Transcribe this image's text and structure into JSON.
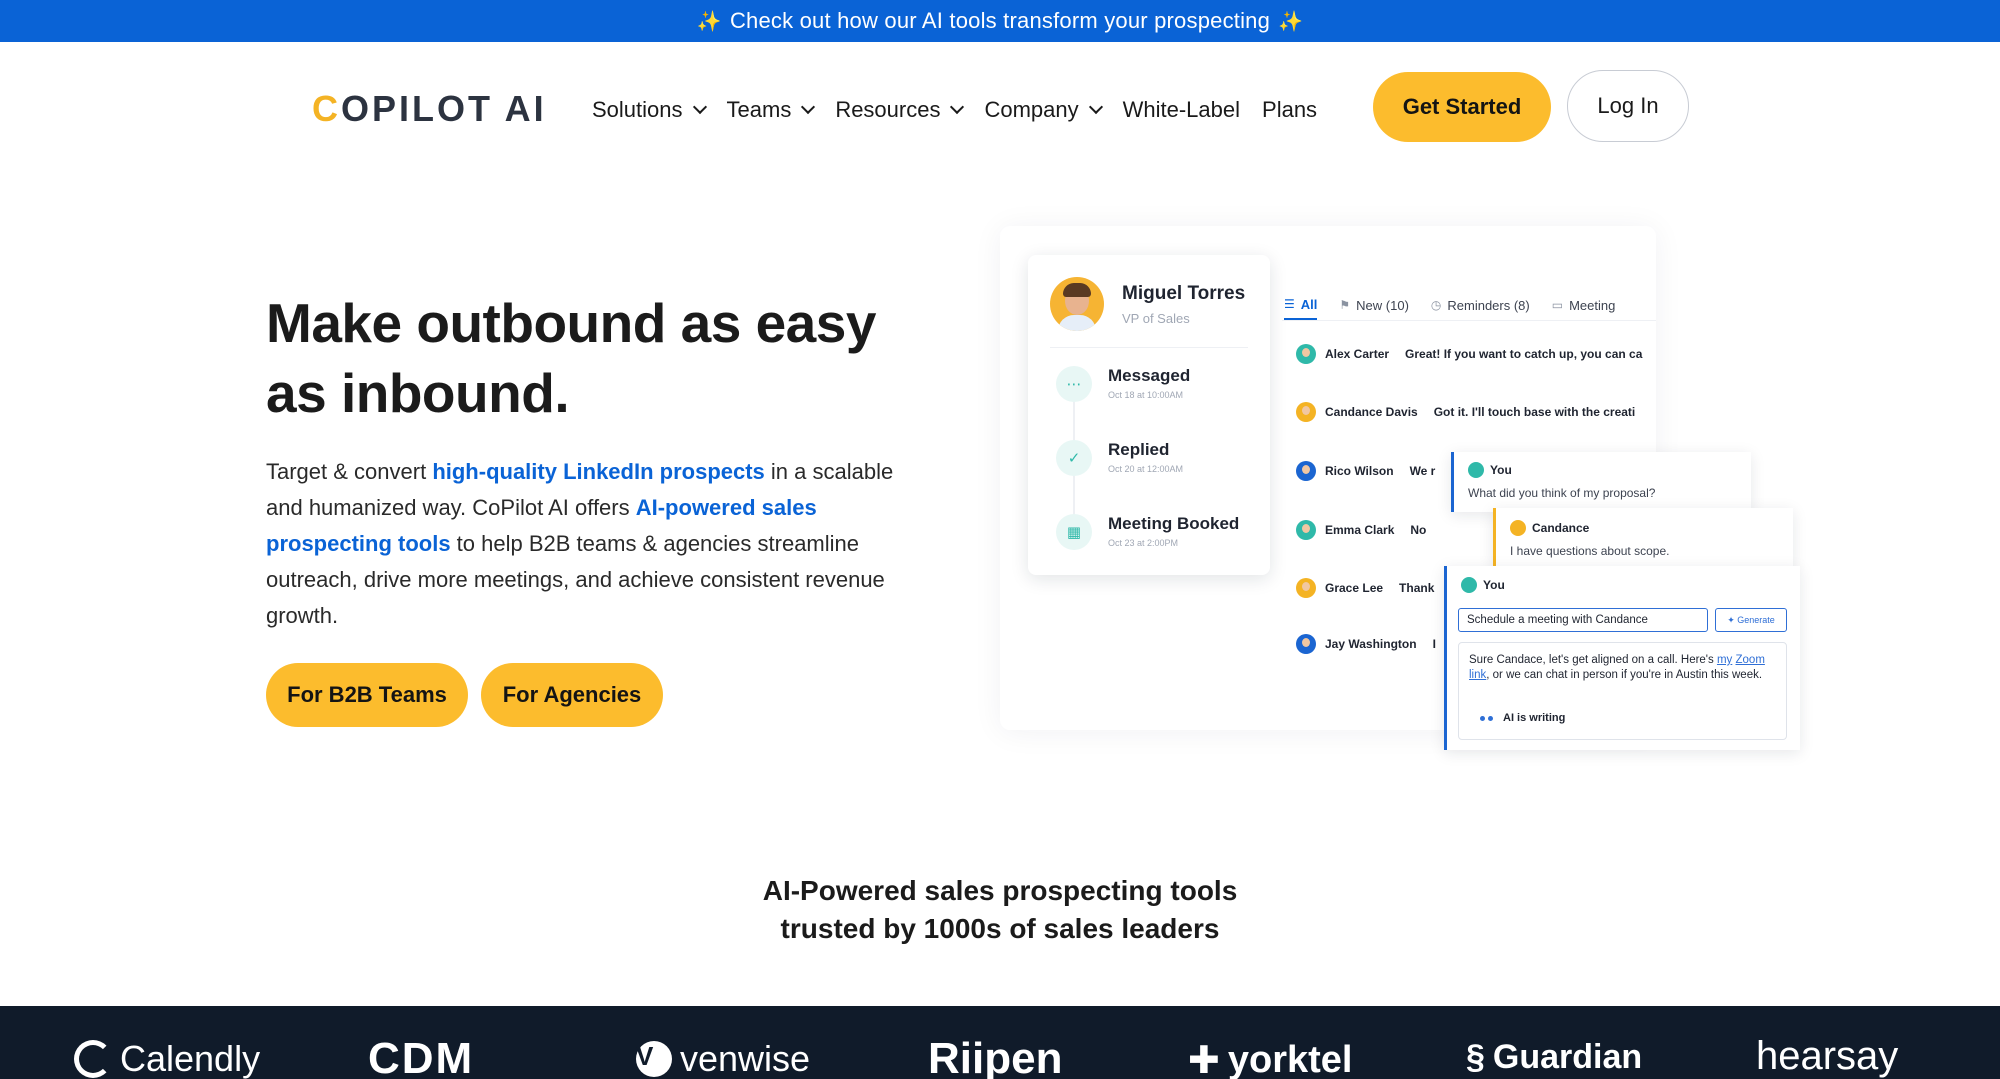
{
  "announcement": {
    "text": "Check out how our AI tools transform your prospecting",
    "spark": "✨"
  },
  "header": {
    "logo_c": "C",
    "logo_rest": "OPILOT AI",
    "nav": [
      {
        "label": "Solutions",
        "dropdown": true
      },
      {
        "label": "Teams",
        "dropdown": true
      },
      {
        "label": "Resources",
        "dropdown": true
      },
      {
        "label": "Company",
        "dropdown": true
      },
      {
        "label": "White-Label",
        "dropdown": false
      },
      {
        "label": "Plans",
        "dropdown": false
      }
    ],
    "get_started": "Get Started",
    "login": "Log In"
  },
  "hero": {
    "title": "Make outbound as easy as inbound.",
    "text_1": "Target & convert ",
    "link_1": "high-quality LinkedIn prospects",
    "text_2": " in a scalable and humanized way. CoPilot AI offers ",
    "link_2": "AI-powered sales prospecting tools",
    "text_3": " to help B2B teams & agencies streamline outreach, drive more meetings, and achieve consistent revenue growth.",
    "cta_b2b": "For B2B Teams",
    "cta_agencies": "For Agencies"
  },
  "mockup": {
    "profile": {
      "name": "Miguel Torres",
      "role": "VP of Sales"
    },
    "timeline": [
      {
        "label": "Messaged",
        "time": "Oct 18 at 10:00AM"
      },
      {
        "label": "Replied",
        "time": "Oct 20 at 12:00AM"
      },
      {
        "label": "Meeting Booked",
        "time": "Oct 23 at 2:00PM"
      }
    ],
    "tabs": [
      {
        "label": "All"
      },
      {
        "label": "New (10)"
      },
      {
        "label": "Reminders (8)"
      },
      {
        "label": "Meeting"
      }
    ],
    "conversations": [
      {
        "name": "Alex Carter",
        "message": "Great! If you want to catch up, you can ca",
        "color": "#2fb9a9"
      },
      {
        "name": "Candance Davis",
        "message": "Got it. I'll touch base with the creati",
        "color": "#f4b324"
      },
      {
        "name": "Rico Wilson",
        "message": "We r",
        "color": "#1b65d1"
      },
      {
        "name": "Emma Clark",
        "message": "No",
        "color": "#2fb9a9"
      },
      {
        "name": "Grace Lee",
        "message": "Thank",
        "color": "#f4b324"
      },
      {
        "name": "Jay Washington",
        "message": "I",
        "color": "#1b65d1"
      }
    ],
    "bubble_you_1": {
      "who": "You",
      "text": "What did you think of my proposal?"
    },
    "bubble_candance": {
      "who": "Candance",
      "text": "I have questions about scope."
    },
    "bubble_you_2": {
      "who": "You",
      "input": "Schedule a meeting with Candance",
      "generate": "✦ Generate",
      "draft_1": "Sure Candace, let's get aligned on a call. Here's ",
      "draft_link_1": "my",
      "draft_link_2": "Zoom link",
      "draft_2": ", or we can chat in person if you're in Austin this week.",
      "ai_writing": "AI is writing"
    }
  },
  "trust": {
    "line_1": "AI-Powered sales prospecting tools",
    "line_2": "trusted by 1000s of sales leaders"
  },
  "logos": [
    "Calendly",
    "CDM",
    "venwise",
    "Riipen",
    "yorktel",
    "Guardian",
    "hearsay"
  ]
}
